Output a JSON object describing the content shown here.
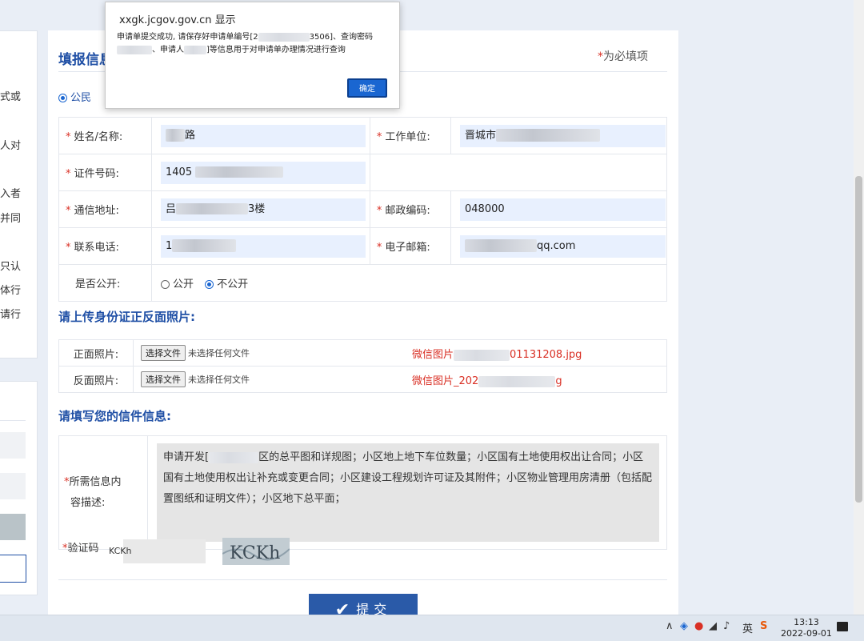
{
  "dialog": {
    "title": "xxgk.jcgov.gov.cn 显示",
    "message_part1": "申请单提交成功, 请保存好申请单编号[2",
    "message_part2": "3506]、查询密码",
    "message_part3": "申请人",
    "message_part4": "]等信息用于对申请单办理情况进行查询",
    "ok_label": "确定"
  },
  "left_fragments": [
    "式或",
    "人对",
    "入者",
    "并同",
    "只认",
    "体行",
    "请行"
  ],
  "form": {
    "title": "填报信息",
    "required_note_star": "*",
    "required_note": "为必填项",
    "applicant_type": "公民",
    "fields": {
      "name_label": "姓名/名称:",
      "name_value": "路",
      "employer_label": "工作单位:",
      "employer_value": "晋城市",
      "id_label": "证件号码:",
      "id_value": "1405",
      "address_label": "通信地址:",
      "address_value_a": "吕",
      "address_value_b": "3楼",
      "postcode_label": "邮政编码:",
      "postcode_value": "048000",
      "phone_label": "联系电话:",
      "phone_value": "1",
      "email_label": "电子邮箱:",
      "email_value": "qq.com",
      "public_label": "是否公开:",
      "public_option": "公开",
      "private_option": "不公开"
    }
  },
  "upload": {
    "title": "请上传身份证正反面照片:",
    "front_label": "正面照片:",
    "back_label": "反面照片:",
    "choose_button": "选择文件",
    "no_file": "未选择任何文件",
    "front_file_a": "微信图片",
    "front_file_b": "01131208.jpg",
    "back_file_a": "微信图片_202",
    "back_file_b": "g"
  },
  "letter": {
    "title": "请填写您的信件信息:",
    "desc_label_line1": "所需信息内",
    "desc_label_line2": "容描述:",
    "content_a": "申请开发[",
    "content_b": "区的总平图和详规图；小区地上地下车位数量；小区国有土地使用权出让合同；小区国有土地使用权出让补充或变更合同；小区建设工程规划许可证及其附件；小区物业管理用房清册（包括配置图纸和证明文件）；小区地下总平面；"
  },
  "captcha": {
    "label": "验证码",
    "value": "KCKh",
    "image_text": "KCKh"
  },
  "submit_label": "提交",
  "taskbar": {
    "time": "13:13",
    "date": "2022-09-01",
    "ime": "英"
  },
  "colors": {
    "accent": "#1a66d1",
    "title_blue": "#1f4fa5",
    "required_red": "#d93025",
    "submit_bg": "#2a5aa8",
    "field_bg": "#e8f0fe"
  }
}
